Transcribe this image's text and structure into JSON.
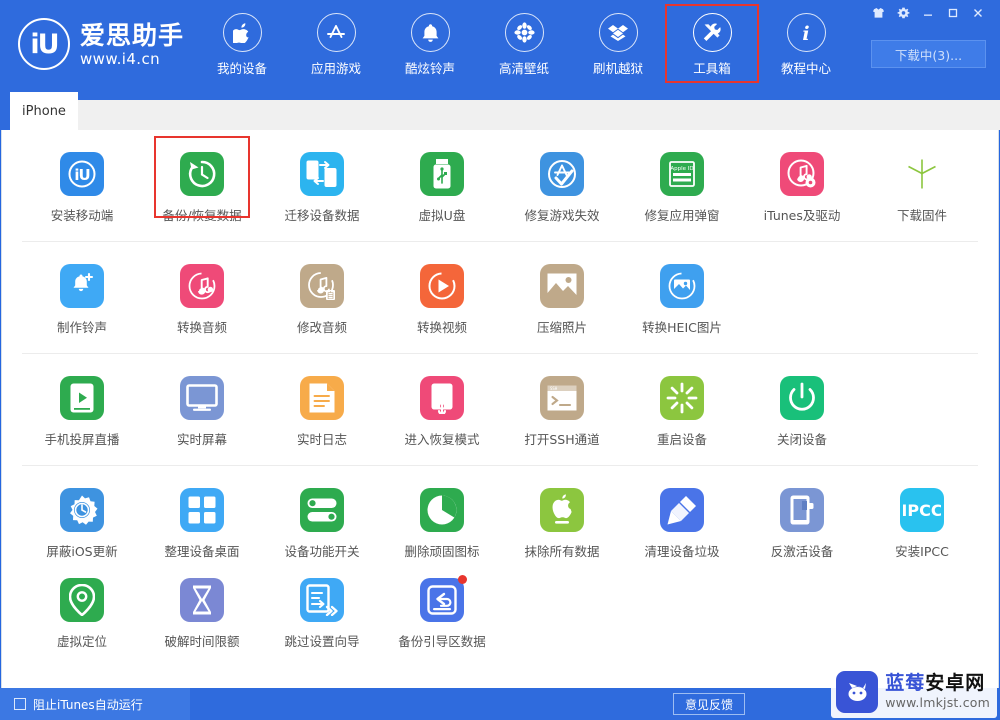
{
  "brand": {
    "logo_text": "iU",
    "name": "爱思助手",
    "url": "www.i4.cn"
  },
  "nav": {
    "items": [
      {
        "label": "我的设备",
        "icon": "apple-icon",
        "active": false
      },
      {
        "label": "应用游戏",
        "icon": "appstore-icon",
        "active": false
      },
      {
        "label": "酷炫铃声",
        "icon": "bell-icon",
        "active": false
      },
      {
        "label": "高清壁纸",
        "icon": "flower-icon",
        "active": false
      },
      {
        "label": "刷机越狱",
        "icon": "dropbox-icon",
        "active": false
      },
      {
        "label": "工具箱",
        "icon": "tools-icon",
        "active": true
      },
      {
        "label": "教程中心",
        "icon": "info-icon",
        "active": false
      }
    ],
    "highlight_color": "#e8352e"
  },
  "window_controls": [
    {
      "name": "skin-icon",
      "glyph": "skin"
    },
    {
      "name": "settings-icon",
      "glyph": "gear"
    },
    {
      "name": "minimize-icon",
      "glyph": "minimize"
    },
    {
      "name": "maximize-icon",
      "glyph": "maximize"
    },
    {
      "name": "close-icon",
      "glyph": "close"
    }
  ],
  "download_button": {
    "label": "下载中(3)..."
  },
  "tabs": [
    {
      "label": "iPhone",
      "active": true
    }
  ],
  "tool_rows": [
    {
      "separator": true,
      "tools": [
        {
          "label": "安装移动端",
          "icon": "i4-app-icon",
          "bg": "#2f8ae8",
          "highlight": false,
          "badge": false
        },
        {
          "label": "备份/恢复数据",
          "icon": "backup-restore-icon",
          "bg": "#2eab4f",
          "highlight": true,
          "badge": false
        },
        {
          "label": "迁移设备数据",
          "icon": "migrate-data-icon",
          "bg": "#2cb4ef",
          "highlight": false,
          "badge": false
        },
        {
          "label": "虚拟U盘",
          "icon": "usb-drive-icon",
          "bg": "#2eab4f",
          "highlight": false,
          "badge": false
        },
        {
          "label": "修复游戏失效",
          "icon": "appstore-fix-icon",
          "bg": "#3e93e0",
          "highlight": false,
          "badge": false
        },
        {
          "label": "修复应用弹窗",
          "icon": "apple-id-icon",
          "bg": "#2eab4f",
          "highlight": false,
          "badge": false
        },
        {
          "label": "iTunes及驱动",
          "icon": "itunes-driver-icon",
          "bg": "#ef4a78",
          "highlight": false,
          "badge": false
        },
        {
          "label": "下载固件",
          "icon": "firmware-box-icon",
          "bg": "#8cc council",
          "highlight": false,
          "badge": false
        }
      ]
    },
    {
      "separator": true,
      "tools": [
        {
          "label": "制作铃声",
          "icon": "ringtone-make-icon",
          "bg": "#3fa9f5",
          "highlight": false,
          "badge": false
        },
        {
          "label": "转换音频",
          "icon": "audio-convert-icon",
          "bg": "#ef4a78",
          "highlight": false,
          "badge": false
        },
        {
          "label": "修改音频",
          "icon": "audio-edit-icon",
          "bg": "#bfa98a",
          "highlight": false,
          "badge": false
        },
        {
          "label": "转换视频",
          "icon": "video-convert-icon",
          "bg": "#f4663a",
          "highlight": false,
          "badge": false
        },
        {
          "label": "压缩照片",
          "icon": "photo-compress-icon",
          "bg": "#bfa98a",
          "highlight": false,
          "badge": false
        },
        {
          "label": "转换HEIC图片",
          "icon": "heic-convert-icon",
          "bg": "#3fa0ef",
          "highlight": false,
          "badge": false
        }
      ]
    },
    {
      "separator": true,
      "tools": [
        {
          "label": "手机投屏直播",
          "icon": "screen-cast-icon",
          "bg": "#2eab4f",
          "highlight": false,
          "badge": false
        },
        {
          "label": "实时屏幕",
          "icon": "live-screen-icon",
          "bg": "#7b96d4",
          "highlight": false,
          "badge": false
        },
        {
          "label": "实时日志",
          "icon": "live-log-icon",
          "bg": "#f7ab4a",
          "highlight": false,
          "badge": false
        },
        {
          "label": "进入恢复模式",
          "icon": "recovery-mode-icon",
          "bg": "#ef4a78",
          "highlight": false,
          "badge": false
        },
        {
          "label": "打开SSH通道",
          "icon": "ssh-terminal-icon",
          "bg": "#bfa98a",
          "highlight": false,
          "badge": false
        },
        {
          "label": "重启设备",
          "icon": "reboot-icon",
          "bg": "#8cc63f",
          "highlight": false,
          "badge": false
        },
        {
          "label": "关闭设备",
          "icon": "power-off-icon",
          "bg": "#19c07a",
          "highlight": false,
          "badge": false
        }
      ]
    },
    {
      "separator": false,
      "tools": [
        {
          "label": "屏蔽iOS更新",
          "icon": "block-update-icon",
          "bg": "#3e93e0",
          "highlight": false,
          "badge": false
        },
        {
          "label": "整理设备桌面",
          "icon": "arrange-home-icon",
          "bg": "#3fa9f5",
          "highlight": false,
          "badge": false
        },
        {
          "label": "设备功能开关",
          "icon": "feature-toggle-icon",
          "bg": "#2eab4f",
          "highlight": false,
          "badge": false
        },
        {
          "label": "删除顽固图标",
          "icon": "remove-icon-icon",
          "bg": "#2eab4f",
          "highlight": false,
          "badge": false
        },
        {
          "label": "抹除所有数据",
          "icon": "erase-all-icon",
          "bg": "#8cc63f",
          "highlight": false,
          "badge": false
        },
        {
          "label": "清理设备垃圾",
          "icon": "clean-junk-icon",
          "bg": "#4a74e8",
          "highlight": false,
          "badge": false
        },
        {
          "label": "反激活设备",
          "icon": "deactivate-icon",
          "bg": "#7b96d4",
          "highlight": false,
          "badge": false
        },
        {
          "label": "安装IPCC",
          "icon": "ipcc-icon",
          "bg": "#29c2ef",
          "highlight": false,
          "badge": false
        }
      ]
    },
    {
      "separator": false,
      "tools": [
        {
          "label": "虚拟定位",
          "icon": "virtual-location-icon",
          "bg": "#2eab4f",
          "highlight": false,
          "badge": false
        },
        {
          "label": "破解时间限额",
          "icon": "hourglass-icon",
          "bg": "#7b88d4",
          "highlight": false,
          "badge": false
        },
        {
          "label": "跳过设置向导",
          "icon": "skip-setup-icon",
          "bg": "#3fa9f5",
          "highlight": false,
          "badge": false
        },
        {
          "label": "备份引导区数据",
          "icon": "backup-boot-icon",
          "bg": "#4a74e8",
          "highlight": false,
          "badge": true
        }
      ]
    }
  ],
  "statusbar": {
    "checkbox_label": "阻止iTunes自动运行",
    "checked": false,
    "feedback_label": "意见反馈"
  },
  "watermark": {
    "title_blue": "蓝莓",
    "title_black": "安卓网",
    "url": "www.lmkjst.com"
  }
}
